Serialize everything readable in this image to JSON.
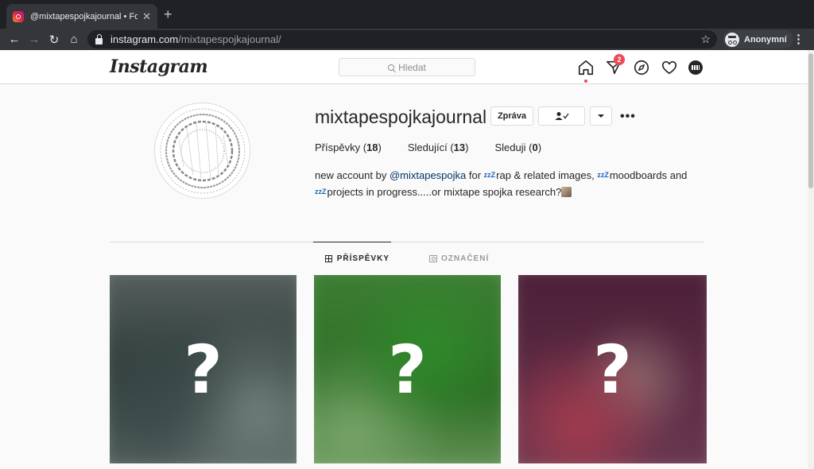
{
  "browser": {
    "tab_title": "@mixtapespojkajournal • Fotky",
    "tab_close": "✕",
    "new_tab": "+",
    "url_host": "instagram.com",
    "url_path": "/mixtapespojkajournal/",
    "profile_label": "Anonymní"
  },
  "ig": {
    "logo": "Instagram",
    "search_placeholder": "Hledat",
    "notification_count": "2",
    "accent_color": "#ed4956"
  },
  "profile": {
    "username": "mixtapespojkajournal",
    "message_button": "Zpráva",
    "stats": {
      "posts_label": "Příspěvky",
      "posts_count": "18",
      "followers_label": "Sledující",
      "followers_count": "13",
      "following_label": "Sleduji",
      "following_count": "0"
    },
    "bio": {
      "part1": "new account by ",
      "mention": "@mixtapespojka",
      "part2": " for ",
      "part3": "rap & related images, ",
      "part4": "moodboards and",
      "part5": "projects in progress.....or mixtape spojka research?",
      "zz": "zzZ"
    }
  },
  "tabs": {
    "posts": "PŘÍSPĚVKY",
    "tagged": "OZNAČENÍ"
  },
  "posts": [
    {
      "placeholder": "?"
    },
    {
      "placeholder": "?"
    },
    {
      "placeholder": "?"
    }
  ]
}
